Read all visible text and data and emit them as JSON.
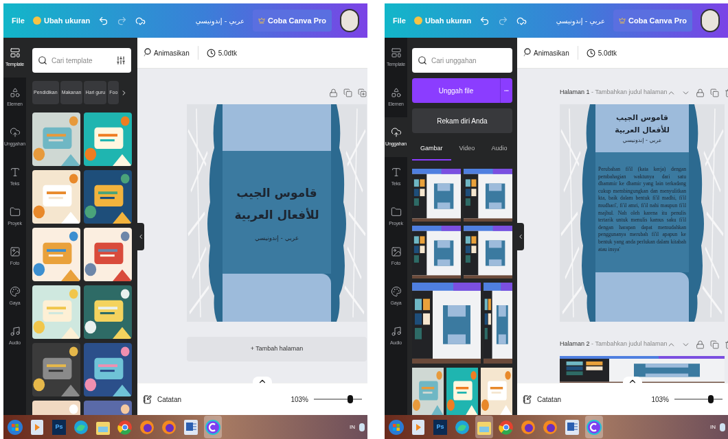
{
  "screens": [
    {
      "top_bar": {
        "file": "File",
        "resize": "Ubah ukuran",
        "doc_title": "عربي - إندونيسي",
        "pro": "Coba Canva Pro"
      },
      "rail": [
        {
          "kind": "template",
          "label": "Template",
          "selected": true
        },
        {
          "kind": "elements",
          "label": "Elemen",
          "selected": false
        },
        {
          "kind": "upload",
          "label": "Unggahan",
          "selected": false
        },
        {
          "kind": "text",
          "label": "Teks",
          "selected": false
        },
        {
          "kind": "project",
          "label": "Proyek",
          "selected": false
        },
        {
          "label": "Foto",
          "selected": false
        },
        {
          "kind": "style",
          "label": "Gaya",
          "selected": false
        },
        {
          "kind": "audio",
          "label": "Audio",
          "selected": false
        }
      ],
      "panel": {
        "kind": "templates",
        "search": {
          "placeholder": "Cari template"
        },
        "chips": [
          "Pendidikan",
          "Makanan",
          "Hari guru",
          "Foo"
        ],
        "thumbnails": [
          {
            "kind": "picture"
          },
          {
            "kind": "picture"
          },
          {
            "kind": "picture"
          },
          {
            "kind": "picture"
          },
          {
            "kind": "picture"
          },
          {
            "kind": "picture"
          },
          {
            "kind": "picture"
          },
          {
            "kind": "picture"
          },
          {
            "kind": "picture"
          },
          {
            "kind": "picture"
          },
          {
            "kind": "picture"
          },
          {
            "kind": "picture"
          }
        ]
      },
      "toolbar": {
        "animate": "Animasikan",
        "duration": "5.0dtk"
      },
      "pages": [
        {
          "kind": "slide",
          "actions": [
            {
              "kind": "lock"
            },
            {
              "kind": "copy"
            },
            {
              "kind": "add"
            }
          ],
          "slide": {
            "title_lines": [
              "قاموس الجيب",
              "للأفعال العربية"
            ],
            "subtitle": "عربي - إندونيسي"
          }
        }
      ],
      "add_page": "+ Tambah halaman",
      "footer": {
        "notes": "Catatan",
        "zoom": "103%",
        "level": 0.75
      }
    },
    {
      "top_bar": {
        "file": "File",
        "resize": "Ubah ukuran",
        "doc_title": "عربي - إندونيسي",
        "pro": "Coba Canva Pro"
      },
      "rail": [
        {
          "kind": "template",
          "label": "Template",
          "selected": false
        },
        {
          "kind": "elements",
          "label": "Elemen",
          "selected": false
        },
        {
          "kind": "upload",
          "label": "Unggahan",
          "selected": true
        },
        {
          "kind": "text",
          "label": "Teks",
          "selected": false
        },
        {
          "kind": "project",
          "label": "Proyek",
          "selected": false
        },
        {
          "label": "Foto",
          "selected": false
        },
        {
          "kind": "style",
          "label": "Gaya",
          "selected": false
        },
        {
          "kind": "audio",
          "label": "Audio",
          "selected": false
        }
      ],
      "panel": {
        "kind": "uploads",
        "search": {
          "placeholder": "Cari unggahan"
        },
        "upload_button": "Unggah file",
        "more": "•••",
        "record_button": "Rekam diri Anda",
        "tabs": [
          {
            "label": "Gambar",
            "selected": true
          },
          {
            "label": "Video",
            "selected": false
          },
          {
            "label": "Audio",
            "selected": false
          }
        ],
        "upload_rows": [
          [
            {
              "kind": "picture"
            },
            {
              "kind": "picture"
            }
          ],
          [
            {
              "kind": "picture"
            },
            {
              "kind": "picture"
            }
          ],
          [
            {
              "kind": "picture",
              "wide": true
            },
            {
              "kind": "picture",
              "wide": false
            }
          ],
          [
            {
              "kind": "picture"
            },
            {
              "kind": "picture"
            },
            {
              "kind": "picture"
            }
          ]
        ]
      },
      "toolbar": {
        "animate": "Animasikan",
        "duration": "5.0dtk"
      },
      "pages": [
        {
          "kind": "slide",
          "label": "Halaman 1",
          "separator": "-",
          "title_placeholder": "Tambahkan judul halaman",
          "actions": [
            {
              "kind": "up"
            },
            {
              "kind": "down"
            },
            {
              "kind": "lock"
            },
            {
              "kind": "copy"
            },
            {
              "kind": "trash"
            }
          ],
          "slide": {
            "title_lines": [
              "قاموس الجيب",
              "للأفعال العربية"
            ],
            "subtitle": "عربي - إندونيسي",
            "paragraph": "Perubahan fi'il (kata kerja) dengan pembahagian waktunya dari satu dhammir ke dhamir yang lain terkadang cukup membingungkan dan menyulitkan kta, baik dalam bentuk fi'il madhi, fi'il mudhari', fi'il amri, fi'il nahi maupun fi'il majhul. Nah oleh karena itu penulis tertarik untuk menulis kamus saku fi'il dengan harapan dapat memudahkan penggunanya merubah fi'il apapun ke bentuk yang anda perlukan dalam kitabah atau insya'"
          }
        },
        {
          "kind": "picture",
          "label": "Halaman 2",
          "separator": "-",
          "title_placeholder": "Tambahkan judul halaman",
          "actions": [
            {
              "kind": "up"
            },
            {
              "kind": "down"
            },
            {
              "kind": "lock"
            },
            {
              "kind": "copy"
            },
            {
              "kind": "trash"
            }
          ]
        }
      ],
      "footer": {
        "notes": "Catatan",
        "zoom": "103%",
        "level": 0.75
      }
    }
  ],
  "taskbars": [
    {
      "items": [
        {
          "kind": "start",
          "highlighted": false
        },
        {
          "kind": "player",
          "highlighted": false
        },
        {
          "kind": "photoshop",
          "label": "Ps",
          "highlighted": false
        },
        {
          "kind": "edge",
          "highlighted": false
        },
        {
          "kind": "folder",
          "highlighted": false
        },
        {
          "kind": "chrome",
          "highlighted": false
        },
        {
          "kind": "firefox",
          "highlighted": false
        },
        {
          "kind": "firefox",
          "highlighted": false
        },
        {
          "kind": "word",
          "highlighted": false
        },
        {
          "kind": "canva",
          "highlighted": true
        }
      ],
      "language": "IN"
    },
    {
      "items": [
        {
          "kind": "start",
          "highlighted": false
        },
        {
          "kind": "player",
          "highlighted": false
        },
        {
          "kind": "photoshop",
          "label": "Ps",
          "highlighted": false
        },
        {
          "kind": "edge",
          "highlighted": false
        },
        {
          "kind": "folder",
          "highlighted": true
        },
        {
          "kind": "chrome",
          "highlighted": false
        },
        {
          "kind": "firefox",
          "highlighted": false
        },
        {
          "kind": "firefox",
          "highlighted": false
        },
        {
          "kind": "word",
          "highlighted": false
        },
        {
          "kind": "canva",
          "highlighted": true
        }
      ],
      "language": "IN"
    }
  ]
}
